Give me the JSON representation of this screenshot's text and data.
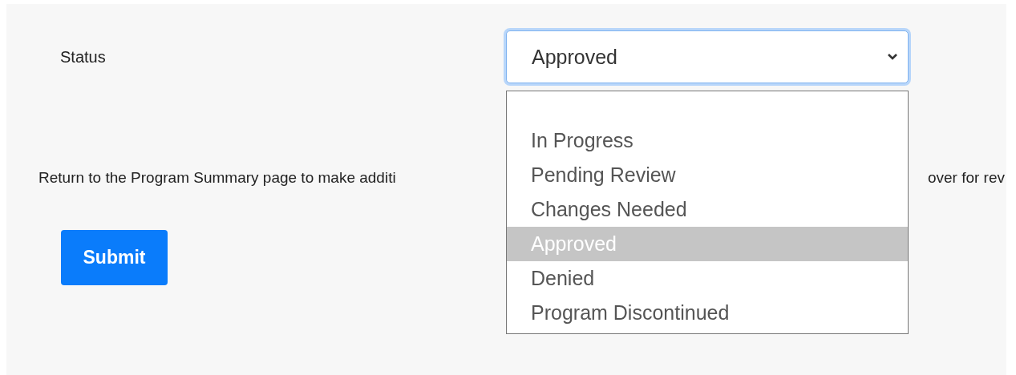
{
  "status_field": {
    "label": "Status",
    "value": "Approved",
    "focused": true,
    "expanded": true,
    "options": [
      {
        "label": "In Progress",
        "selected": false
      },
      {
        "label": "Pending Review",
        "selected": false
      },
      {
        "label": "Changes Needed",
        "selected": false
      },
      {
        "label": "Approved",
        "selected": true
      },
      {
        "label": "Denied",
        "selected": false
      },
      {
        "label": "Program Discontinued",
        "selected": false
      }
    ]
  },
  "notice": {
    "text_before": "Return to the Program Summary page to make additi",
    "text_after": "over for rev"
  },
  "buttons": [
    {
      "label": "Submit",
      "kind": "primary"
    }
  ]
}
